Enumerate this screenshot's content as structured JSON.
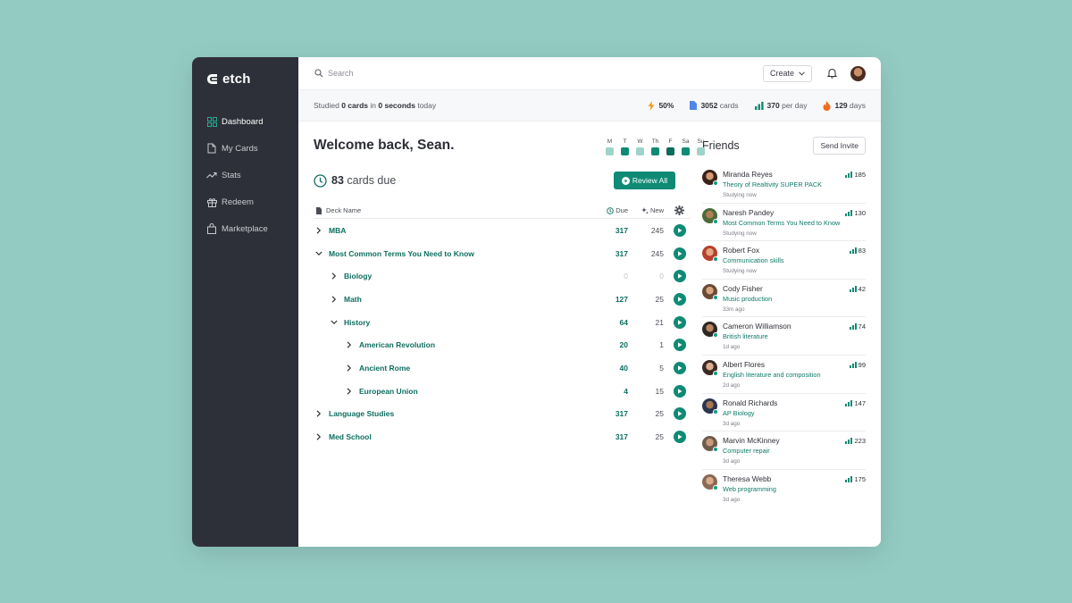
{
  "app": {
    "logo": "etch"
  },
  "sidebar": {
    "items": [
      {
        "label": "Dashboard",
        "icon": "grid-icon",
        "active": true
      },
      {
        "label": "My Cards",
        "icon": "file-icon",
        "active": false
      },
      {
        "label": "Stats",
        "icon": "trend-icon",
        "active": false
      },
      {
        "label": "Redeem",
        "icon": "gift-icon",
        "active": false
      },
      {
        "label": "Marketplace",
        "icon": "bag-icon",
        "active": false
      }
    ]
  },
  "topbar": {
    "search_placeholder": "Search",
    "create_label": "Create"
  },
  "statsbar": {
    "studied_prefix": "Studied",
    "studied_cards": "0 cards",
    "studied_mid": "in",
    "studied_time": "0 seconds",
    "studied_suffix": "today",
    "percent": "50%",
    "cards_value": "3052",
    "cards_unit": "cards",
    "per_day_value": "370",
    "per_day_unit": "per day",
    "streak_value": "129",
    "streak_unit": "days"
  },
  "main": {
    "welcome": "Welcome back, Sean.",
    "week": [
      {
        "label": "M",
        "color": "#9fd3c9"
      },
      {
        "label": "T",
        "color": "#0f8a75"
      },
      {
        "label": "W",
        "color": "#9fd3c9"
      },
      {
        "label": "Th",
        "color": "#0f8a75"
      },
      {
        "label": "F",
        "color": "#0c6b5c"
      },
      {
        "label": "Sa",
        "color": "#0f8a75"
      },
      {
        "label": "Su",
        "color": "#9fd3c9"
      }
    ],
    "cards_due_count": "83",
    "cards_due_label": "cards due",
    "review_all": "Review All"
  },
  "table": {
    "headers": {
      "name": "Deck Name",
      "due": "Due",
      "new": "New"
    },
    "rows": [
      {
        "name": "MBA",
        "due": "317",
        "new": "245",
        "level": 0,
        "expanded": false
      },
      {
        "name": "Most Common Terms You Need to Know",
        "due": "317",
        "new": "245",
        "level": 0,
        "expanded": true
      },
      {
        "name": "Biology",
        "due": "0",
        "new": "0",
        "level": 1,
        "expanded": false
      },
      {
        "name": "Math",
        "due": "127",
        "new": "25",
        "level": 1,
        "expanded": false
      },
      {
        "name": "History",
        "due": "64",
        "new": "21",
        "level": 1,
        "expanded": true
      },
      {
        "name": "American Revolution",
        "due": "20",
        "new": "1",
        "level": 2,
        "expanded": false
      },
      {
        "name": "Ancient Rome",
        "due": "40",
        "new": "5",
        "level": 2,
        "expanded": false
      },
      {
        "name": "European Union",
        "due": "4",
        "new": "15",
        "level": 2,
        "expanded": false
      },
      {
        "name": "Language Studies",
        "due": "317",
        "new": "25",
        "level": 0,
        "expanded": false
      },
      {
        "name": "Med School",
        "due": "317",
        "new": "25",
        "level": 0,
        "expanded": false
      }
    ]
  },
  "friends": {
    "title": "Friends",
    "invite": "Send Invite",
    "list": [
      {
        "name": "Miranda Reyes",
        "deck": "Theory of Realtivity SUPER PACK",
        "status": "Studying now",
        "score": "185",
        "online": true
      },
      {
        "name": "Naresh Pandey",
        "deck": "Most Common Terms You Need to Know",
        "status": "Studying now",
        "score": "130",
        "online": true
      },
      {
        "name": "Robert Fox",
        "deck": "Communication skills",
        "status": "Studying now",
        "score": "83",
        "online": true
      },
      {
        "name": "Cody Fisher",
        "deck": "Music production",
        "status": "33m ago",
        "score": "42",
        "online": true
      },
      {
        "name": "Cameron Williamson",
        "deck": "British literature",
        "status": "1d ago",
        "score": "74",
        "online": true
      },
      {
        "name": "Albert Flores",
        "deck": "English literature and composition",
        "status": "2d ago",
        "score": "99",
        "online": true
      },
      {
        "name": "Ronald Richards",
        "deck": "AP Biology",
        "status": "3d ago",
        "score": "147",
        "online": true
      },
      {
        "name": "Marvin McKinney",
        "deck": "Computer repair",
        "status": "3d ago",
        "score": "223",
        "online": true
      },
      {
        "name": "Theresa Webb",
        "deck": "Web programming",
        "status": "3d ago",
        "score": "175",
        "online": true
      }
    ]
  },
  "colors": {
    "accent": "#0f8a75",
    "sidebar": "#2e3039",
    "background": "#93cbc3"
  }
}
